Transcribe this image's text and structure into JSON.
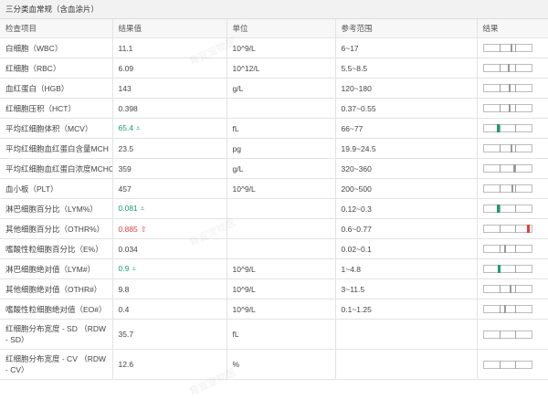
{
  "title": "三分类血常规（含血涂片）",
  "headers": [
    "检查项目",
    "结果值",
    "单位",
    "参考范围",
    "结果"
  ],
  "rows": [
    {
      "name": "白细胞（WBC）",
      "value": "11.1",
      "unit": "10^9/L",
      "range": "6~17",
      "status": "normal",
      "position": 0.6
    },
    {
      "name": "红细胞（RBC）",
      "value": "6.09",
      "unit": "10^12/L",
      "range": "5.5~8.5",
      "status": "normal",
      "position": 0.53
    },
    {
      "name": "血红蛋白（HGB）",
      "value": "143",
      "unit": "g/L",
      "range": "120~180",
      "status": "normal",
      "position": 0.55
    },
    {
      "name": "红细胞压积（HCT）",
      "value": "0.398",
      "unit": "",
      "range": "0.37~0.55",
      "status": "normal",
      "position": 0.55
    },
    {
      "name": "平均红细胞体积（MCV）",
      "value": "65.4",
      "unit": "fL",
      "range": "66~77",
      "status": "low",
      "position": 0.28
    },
    {
      "name": "平均红细胞血红蛋白含量MCH",
      "value": "23.5",
      "unit": "pg",
      "range": "19.9~24.5",
      "status": "normal",
      "position": 0.6
    },
    {
      "name": "平均红细胞血红蛋白浓度MCHC",
      "value": "359",
      "unit": "g/L",
      "range": "320~360",
      "status": "normal",
      "position": 0.65
    },
    {
      "name": "血小板（PLT）",
      "value": "457",
      "unit": "10^9/L",
      "range": "200~500",
      "status": "normal",
      "position": 0.62
    },
    {
      "name": "淋巴细胞百分比（LYM%）",
      "value": "0.081",
      "unit": "",
      "range": "0.12~0.3",
      "status": "low",
      "position": 0.28
    },
    {
      "name": "其他细胞百分比（OTHR%）",
      "value": "0.885",
      "unit": "",
      "range": "0.6~0.77",
      "status": "high",
      "position": 0.95
    },
    {
      "name": "嗜酸性粒细胞百分比（E%）",
      "value": "0.034",
      "unit": "",
      "range": "0.02~0.1",
      "status": "normal",
      "position": 0.45
    },
    {
      "name": "淋巴细胞绝对值（LYM#）",
      "value": "0.9",
      "unit": "10^9/L",
      "range": "1~4.8",
      "status": "low",
      "position": 0.31
    },
    {
      "name": "其他细胞绝对值（OTHR#）",
      "value": "9.8",
      "unit": "10^9/L",
      "range": "3~11.5",
      "status": "normal",
      "position": 0.58
    },
    {
      "name": "嗜酸性粒细胞绝对值（EO#）",
      "value": "0.4",
      "unit": "10^9/L",
      "range": "0.1~1.25",
      "status": "normal",
      "position": 0.45
    },
    {
      "name": "红细胞分布宽度 - SD （RDW - SD）",
      "value": "35.7",
      "unit": "fL",
      "range": "",
      "status": "none",
      "position": null
    },
    {
      "name": "红细胞分布宽度 - CV （RDW - CV）",
      "value": "12.6",
      "unit": "%",
      "range": "",
      "status": "none",
      "position": null
    }
  ],
  "status_colors": {
    "normal": "#444444",
    "low": "#1aa06d",
    "high": "#e04040"
  },
  "arrows": {
    "low": "⩡",
    "high": "⇧"
  },
  "watermark": "育宜宠物医"
}
